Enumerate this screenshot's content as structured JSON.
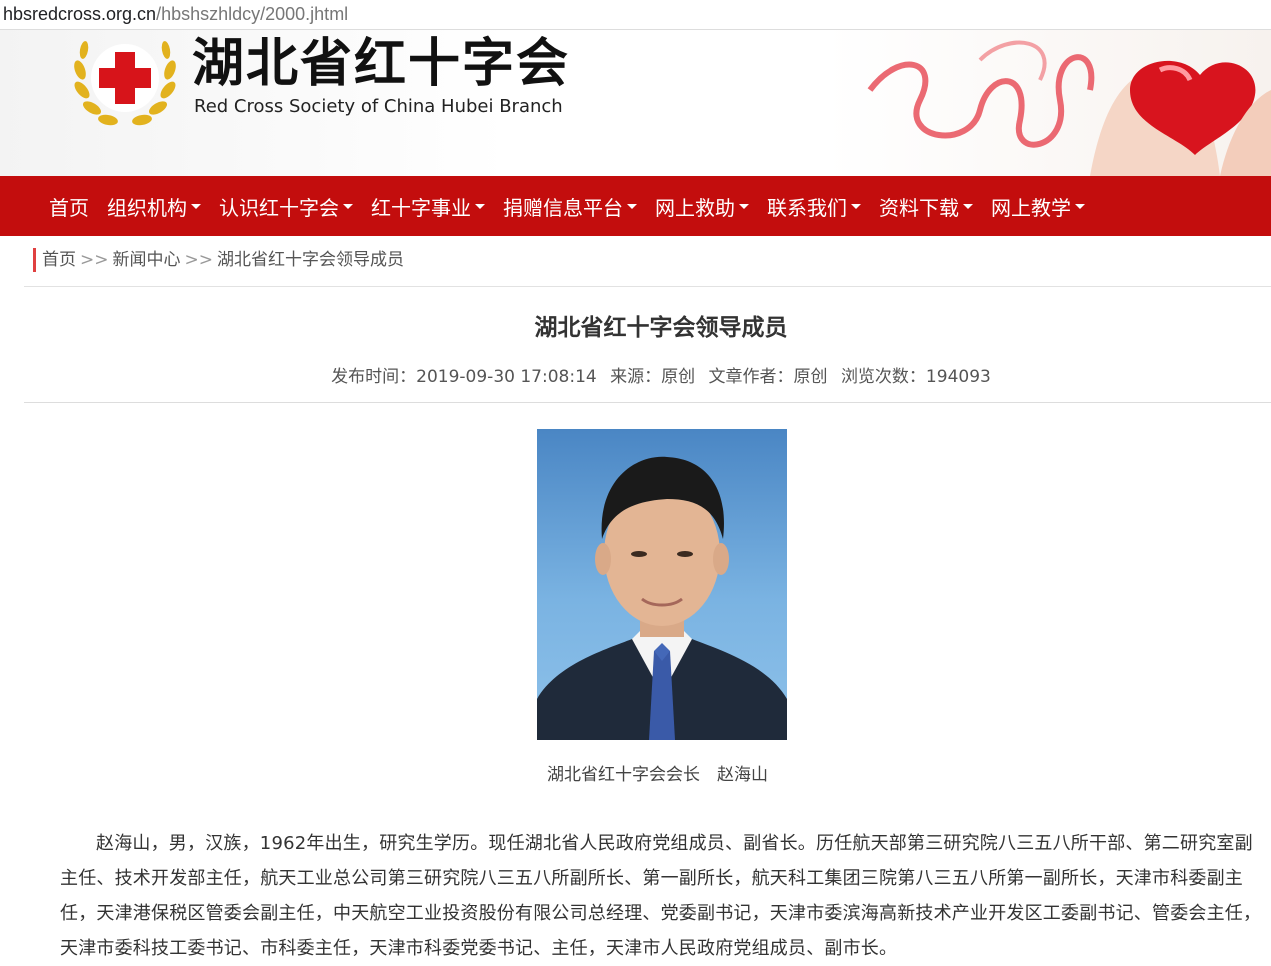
{
  "browser": {
    "url_host": "hbsredcross.org.cn",
    "url_path": "/hbshszhldcy/2000.jhtml"
  },
  "header": {
    "title": "湖北省红十字会",
    "subtitle": "Red Cross Society of China Hubei Branch"
  },
  "nav": {
    "items": [
      {
        "label": "首页",
        "dropdown": false
      },
      {
        "label": "组织机构",
        "dropdown": true
      },
      {
        "label": "认识红十字会",
        "dropdown": true
      },
      {
        "label": "红十字事业",
        "dropdown": true
      },
      {
        "label": "捐赠信息平台",
        "dropdown": true
      },
      {
        "label": "网上救助",
        "dropdown": true
      },
      {
        "label": "联系我们",
        "dropdown": true
      },
      {
        "label": "资料下载",
        "dropdown": true
      },
      {
        "label": "网上教学",
        "dropdown": true
      }
    ]
  },
  "breadcrumb": {
    "home": "首页",
    "separator": ">>",
    "section": "新闻中心",
    "current": "湖北省红十字会领导成员"
  },
  "article": {
    "title": "湖北省红十字会领导成员",
    "meta_published": "发布时间：2019-09-30 17:08:14",
    "meta_source": "来源：原创",
    "meta_author": "文章作者：原创",
    "meta_views": "浏览次数：194093",
    "caption": "湖北省红十字会会长　赵海山",
    "bio": "赵海山，男，汉族，1962年出生，研究生学历。现任湖北省人民政府党组成员、副省长。历任航天部第三研究院八三五八所干部、第二研究室副主任、技术开发部主任，航天工业总公司第三研究院八三五八所副所长、第一副所长，航天科工集团三院第八三五八所第一副所长，天津市科委副主任，天津港保税区管委会副主任，中天航空工业投资股份有限公司总经理、党委副书记，天津市委滨海高新技术产业开发区工委副书记、管委会主任，天津市委科技工委书记、市科委主任，天津市科委党委书记、主任，天津市人民政府党组成员、副市长。"
  },
  "colors": {
    "nav_bg": "#c30d0d",
    "accent": "#e04040"
  }
}
